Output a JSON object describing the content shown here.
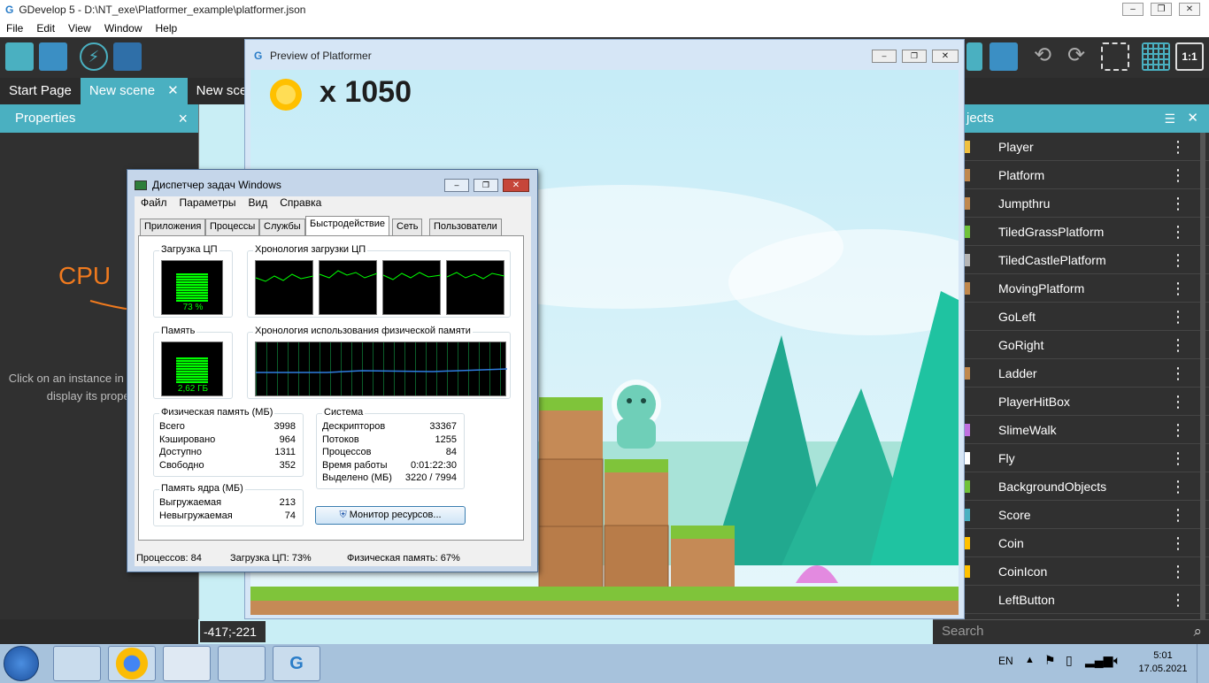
{
  "window": {
    "title": "GDevelop 5 - D:\\NT_exe\\Platformer_example\\platformer.json",
    "minimize": "‒",
    "maximize": "❐",
    "close": "✕"
  },
  "menu": {
    "items": [
      "File",
      "Edit",
      "View",
      "Window",
      "Help"
    ]
  },
  "tabs": {
    "start_page": "Start Page",
    "new_scene_1": "New scene",
    "new_scene_2": "New scen"
  },
  "properties": {
    "title": "Properties",
    "close": "×",
    "hint": "Click on an instance in the scene to display its properties"
  },
  "coords": "-417;-221",
  "objects": {
    "title": "jects",
    "items": [
      {
        "label": "Player",
        "color": "#f0c040"
      },
      {
        "label": "Platform",
        "color": "#c0884d"
      },
      {
        "label": "Jumpthru",
        "color": "#c0884d"
      },
      {
        "label": "TiledGrassPlatform",
        "color": "#6fc23a"
      },
      {
        "label": "TiledCastlePlatform",
        "color": "#b5b5b5"
      },
      {
        "label": "MovingPlatform",
        "color": "#c0884d"
      },
      {
        "label": "GoLeft",
        "color": "#303030"
      },
      {
        "label": "GoRight",
        "color": "#303030"
      },
      {
        "label": "Ladder",
        "color": "#c0884d"
      },
      {
        "label": "PlayerHitBox",
        "color": "#303030"
      },
      {
        "label": "SlimeWalk",
        "color": "#c070e0"
      },
      {
        "label": "Fly",
        "color": "#ffffff"
      },
      {
        "label": "BackgroundObjects",
        "color": "#6fc23a"
      },
      {
        "label": "Score",
        "color": "#4ab0c1"
      },
      {
        "label": "Coin",
        "color": "#ffc000"
      },
      {
        "label": "CoinIcon",
        "color": "#ffc000"
      },
      {
        "label": "LeftButton",
        "color": "#303030"
      }
    ],
    "kebab": "⋮"
  },
  "search": {
    "placeholder": "Search"
  },
  "preview": {
    "title": "Preview of Platformer",
    "coin_count": "x 1050"
  },
  "annotation": {
    "text": "CPU",
    "color": "#f07a1e"
  },
  "task_manager": {
    "title": "Диспетчер задач Windows",
    "menu": [
      "Файл",
      "Параметры",
      "Вид",
      "Справка"
    ],
    "tabs": [
      "Приложения",
      "Процессы",
      "Службы",
      "Быстродействие",
      "Сеть",
      "Пользователи"
    ],
    "cpu_label": "Загрузка ЦП",
    "cpu_value": "73 %",
    "cpu_history_label": "Хронология загрузки ЦП",
    "mem_label": "Память",
    "mem_value": "2,62 ГБ",
    "mem_history_label": "Хронология использования физической памяти",
    "phys_mem": {
      "title": "Физическая память (МБ)",
      "rows": [
        {
          "k": "Всего",
          "v": "3998"
        },
        {
          "k": "Кэшировано",
          "v": "964"
        },
        {
          "k": "Доступно",
          "v": "1311"
        },
        {
          "k": "Свободно",
          "v": "352"
        }
      ]
    },
    "kernel_mem": {
      "title": "Память ядра (МБ)",
      "rows": [
        {
          "k": "Выгружаемая",
          "v": "213"
        },
        {
          "k": "Невыгружаемая",
          "v": "74"
        }
      ]
    },
    "system": {
      "title": "Система",
      "rows": [
        {
          "k": "Дескрипторов",
          "v": "33367"
        },
        {
          "k": "Потоков",
          "v": "1255"
        },
        {
          "k": "Процессов",
          "v": "84"
        },
        {
          "k": "Время работы",
          "v": "0:01:22:30"
        },
        {
          "k": "Выделено (МБ)",
          "v": "3220 / 7994"
        }
      ]
    },
    "resource_monitor_button": "Монитор ресурсов...",
    "status": {
      "processes": "Процессов: 84",
      "cpu": "Загрузка ЦП: 73%",
      "memory": "Физическая память: 67%"
    },
    "cpu_load_fraction": 0.73,
    "mem_load_fraction": 0.67
  },
  "taskbar": {
    "lang": "EN",
    "time": "5:01",
    "date": "17.05.2021"
  }
}
